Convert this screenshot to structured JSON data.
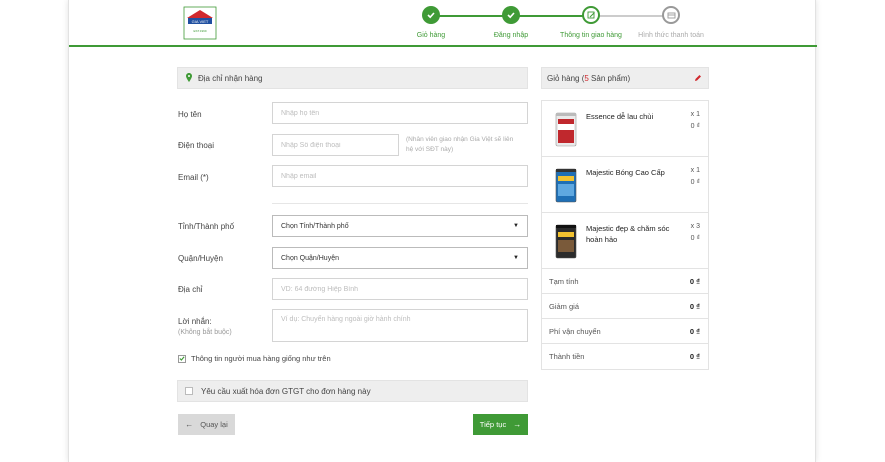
{
  "steps": [
    {
      "label": "Giỏ hàng",
      "state": "done"
    },
    {
      "label": "Đăng nhập",
      "state": "done"
    },
    {
      "label": "Thông tin giao hàng",
      "state": "current"
    },
    {
      "label": "Hình thức thanh toán",
      "state": "pending"
    }
  ],
  "logo": {
    "brand": "GIA VIET",
    "caption": "EST.1999"
  },
  "shipping": {
    "title": "Địa chỉ nhận hàng",
    "name_label": "Họ tên",
    "name_placeholder": "Nhập họ tên",
    "phone_label": "Điện thoại",
    "phone_placeholder": "Nhập Số điện thoại",
    "phone_note": "(Nhân viên giao nhận Gia Việt sẽ liên hệ với SĐT này)",
    "email_label": "Email (*)",
    "email_placeholder": "Nhập email",
    "city_label": "Tỉnh/Thành phố",
    "city_value": "Chọn Tỉnh/Thành phố",
    "district_label": "Quận/Huyện",
    "district_value": "Chọn Quận/Huyện",
    "address_label": "Địa chỉ",
    "address_placeholder": "VD: 64 đường Hiệp Bình",
    "message_label": "Lời nhắn:",
    "message_sub": "(Không bắt buộc)",
    "message_placeholder": "Ví dụ: Chuyển hàng ngoài giờ hành chính",
    "same_buyer_label": "Thông tin người mua hàng giống như trên",
    "same_buyer_checked": true,
    "vat_label": "Yêu cầu xuất hóa đơn GTGT cho đơn hàng này",
    "vat_checked": false
  },
  "buttons": {
    "back": "Quay lại",
    "next": "Tiếp tục"
  },
  "cart": {
    "title_prefix": "Giỏ hàng (",
    "count": "5",
    "title_suffix": " Sản phẩm)",
    "items": [
      {
        "name": "Essence dễ lau chùi",
        "qty": "x 1",
        "price": "0 ₫",
        "can_color": "#c0282d"
      },
      {
        "name": "Majestic Bóng Cao Cấp",
        "qty": "x 1",
        "price": "0 ₫",
        "can_color": "#1f6fb5"
      },
      {
        "name": "Majestic đẹp & chăm sóc hoàn hảo",
        "qty": "x 3",
        "price": "0 ₫",
        "can_color": "#2b2b2b"
      }
    ],
    "summary": [
      {
        "label": "Tạm tính",
        "value": "0 ₫"
      },
      {
        "label": "Giảm giá",
        "value": "0 ₫"
      },
      {
        "label": "Phí vận chuyển",
        "value": "0 ₫"
      },
      {
        "label": "Thành tiền",
        "value": "0 ₫"
      }
    ]
  },
  "colors": {
    "accent": "#3f9a36",
    "cart_count": "#d0282d",
    "pending": "#aaaaaa"
  }
}
